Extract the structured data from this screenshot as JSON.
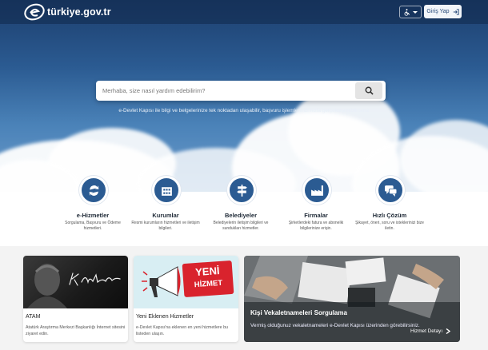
{
  "header": {
    "logo_text": "türkiye.gov.tr",
    "login_label": "Giriş Yap"
  },
  "search": {
    "placeholder": "Merhaba, size nasıl yardım edebilirim?"
  },
  "tagline": "e-Devlet Kapısı ile bilgi ve belgelerinize tek noktadan ulaşabilir, başvuru işlemlerinizi hızla gerçekleştirebilirsiniz",
  "services": [
    {
      "title": "e-Hizmetler",
      "desc": "Sorgulama, Başvuru ve Ödeme hizmetleri.",
      "icon": "refresh-arrows-icon"
    },
    {
      "title": "Kurumlar",
      "desc": "Resmi kurumların hizmetleri ve iletişim bilgileri.",
      "icon": "building-icon"
    },
    {
      "title": "Belediyeler",
      "desc": "Belediyelerin iletişim bilgileri ve sundukları hizmetler.",
      "icon": "signpost-icon"
    },
    {
      "title": "Firmalar",
      "desc": "Şirketlerdeki fatura ve abonelik bilgilerinize erişin.",
      "icon": "factory-icon"
    },
    {
      "title": "Hızlı Çözüm",
      "desc": "Şikayet, öneri, soru ve isteklerinizi bize iletin.",
      "icon": "chat-bubbles-icon"
    }
  ],
  "cards": [
    {
      "title": "ATAM",
      "desc": "Atatürk Araştırma Merkezi Başkanlığı İnternet sitesini ziyaret edin.",
      "signature_text": "K. Atatürk"
    },
    {
      "title": "Yeni Eklenen Hizmetler",
      "desc": "e-Devlet Kapısı'na eklenen en yeni hizmetlere bu listeden ulaşın.",
      "badge_line1": "YENİ",
      "badge_line2": "HİZMET"
    }
  ],
  "featured": {
    "title": "Kişi Vekaletnameleri Sorgulama",
    "desc": "Vermiş olduğunuz vekaletnameleri e-Devlet Kapısı üzerinden görebilirsiniz.",
    "link_label": "Hizmet Detayı"
  },
  "colors": {
    "brand_blue": "#2b5b92",
    "red_badge": "#d9232d"
  }
}
